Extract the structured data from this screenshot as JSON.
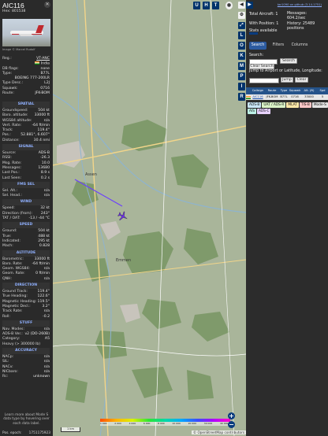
{
  "aircraft": {
    "callsign": "AIC116",
    "hex_label": "Hex:",
    "hex": "801538",
    "photo_credit": "Image © Marcel Rudolf",
    "registration_label": "Reg.:",
    "registration": "VT-ANC",
    "country": "India",
    "db_flags_label": "DB flags:",
    "db_flags": "none",
    "type_label": "Type:",
    "type": "B77L",
    "type_full": "BOEING 777-200LR",
    "type_desc_label": "Type Desc.:",
    "type_desc": "L2J",
    "squawk_label": "Squawk:",
    "squawk": "0716",
    "route_label": "Route:",
    "route": "JFK-BOM"
  },
  "sections": {
    "spatial": "SPATIAL",
    "signal": "SIGNAL",
    "fms": "FMS SEL",
    "wind": "WIND",
    "speed": "SPEED",
    "altitude": "ALTITUDE",
    "direction": "DIRECTION",
    "stuff": "STUFF",
    "accuracy": "ACCURACY"
  },
  "spatial": [
    {
      "k": "Groundspeed:",
      "v": "504 kt"
    },
    {
      "k": "Baro. altitude:",
      "v": "33000 ft"
    },
    {
      "k": "WGS84 altitude:",
      "v": "n/a"
    },
    {
      "k": "Vert. Rate:",
      "v": "-64 ft/min"
    },
    {
      "k": "Track:",
      "v": "119.4°"
    },
    {
      "k": "Pos.:",
      "v": "52.881°, 6.607°"
    },
    {
      "k": "Distance:",
      "v": "30.4 nmi"
    }
  ],
  "signal": [
    {
      "k": "Source:",
      "v": "ADS-B"
    },
    {
      "k": "RSSI:",
      "v": "-26.3"
    },
    {
      "k": "Msg. Rate:",
      "v": "10.0"
    },
    {
      "k": "Messages:",
      "v": "13680"
    },
    {
      "k": "Last Pos.:",
      "v": "8.9 s"
    },
    {
      "k": "Last Seen:",
      "v": "0.2 s"
    }
  ],
  "fms": [
    {
      "k": "Sel. Alt.:",
      "v": "n/a"
    },
    {
      "k": "Sel. Head.:",
      "v": "n/a"
    }
  ],
  "wind": [
    {
      "k": "Speed:",
      "v": "32 kt"
    },
    {
      "k": "Direction (from):",
      "v": "243°"
    },
    {
      "k": "TAT / OAT:",
      "v": "-13 / -44 °C"
    }
  ],
  "speed": [
    {
      "k": "Ground:",
      "v": "504 kt"
    },
    {
      "k": "True:",
      "v": "488 kt"
    },
    {
      "k": "Indicated:",
      "v": "295 kt"
    },
    {
      "k": "Mach:",
      "v": "0.828"
    }
  ],
  "altitude": [
    {
      "k": "Barometric:",
      "v": "33000 ft"
    },
    {
      "k": "Baro. Rate:",
      "v": "-64 ft/min"
    },
    {
      "k": "Geom. WGS84:",
      "v": "n/a"
    },
    {
      "k": "Geom. Rate:",
      "v": "0 ft/min"
    },
    {
      "k": "QNH:",
      "v": "n/a"
    }
  ],
  "direction": [
    {
      "k": "Ground Track:",
      "v": "119.4°"
    },
    {
      "k": "True Heading:",
      "v": "122.6°"
    },
    {
      "k": "Magnetic Heading:",
      "v": "119.5°"
    },
    {
      "k": "Magnetic Decl.:",
      "v": "3.2°"
    },
    {
      "k": "Track Rate:",
      "v": "n/a"
    },
    {
      "k": "Roll:",
      "v": "-0.2"
    }
  ],
  "stuff": [
    {
      "k": "Nav. Modes:",
      "v": "n/a"
    },
    {
      "k": "ADS-B Ver.:",
      "v": "v2 (DO-260B)"
    },
    {
      "k": "Category:",
      "v": "A5"
    },
    {
      "k": "Heavy (> 300000 lb)",
      "v": ""
    }
  ],
  "accuracy": [
    {
      "k": "NACp:",
      "v": "n/a"
    },
    {
      "k": "SIL:",
      "v": "n/a"
    },
    {
      "k": "NACv:",
      "v": "n/a"
    },
    {
      "k": "NICbaro:",
      "v": "n/a"
    },
    {
      "k": "Rc:",
      "v": "unknown"
    }
  ],
  "footer": {
    "learn_more": "Learn more about Mode S data type by hovering over each data label.",
    "epoch_label": "Pos. epoch:",
    "epoch": "1751175923"
  },
  "map": {
    "top_buttons": [
      "U",
      "H",
      "T"
    ],
    "side_buttons": [
      "L",
      "O",
      "K",
      "M",
      "P",
      "I",
      "R"
    ],
    "place_labels": [
      "Assen",
      "Emmen"
    ],
    "scale": "1 km",
    "altitude_ticks": [
      "1 000",
      "2 000",
      "4 000",
      "6 000",
      "8 000",
      "10 000",
      "20 000",
      "30 000",
      "40 000+"
    ],
    "zoom_in": "+",
    "zoom_out": "−",
    "attribution": "© OpenStreetMap contributors"
  },
  "right": {
    "github": "tar1090 on github (3.14.1751)",
    "total_aircraft": "Total Aircraft: 1",
    "with_position": "With Position: 1",
    "stats_available": "Stats available",
    "messages": "Messages: 604.2/sec",
    "history": "History: 25489 positions",
    "tabs": [
      "Search",
      "Filters",
      "Columns"
    ],
    "search_label": "Search:",
    "search_button": "Search",
    "clear_search": "Clear Search",
    "jump_label": "Jump to Airport or Latitude, Longitude:",
    "jump_button": "Jump",
    "clear_button": "Clear"
  },
  "table": {
    "headers": [
      "",
      "Callsign",
      "Route",
      "Type",
      "Squawk",
      "Alt. (ft)",
      "Spd"
    ],
    "row": [
      "",
      "AIC116",
      "JFK-BOM",
      "B77L",
      "0716",
      "33000",
      "5"
    ]
  },
  "source_filters": [
    {
      "label": "ADS-B",
      "color": "#c9e6f7"
    },
    {
      "label": "UAT / ADS-R",
      "color": "#d9f2c6"
    },
    {
      "label": "MLAT",
      "color": "#ffe8a8"
    },
    {
      "label": "TIS-B",
      "color": "#ffc7c7"
    },
    {
      "label": "Mode-S",
      "color": "#e4e4e4"
    },
    {
      "label": "AIS",
      "color": "#bdf0e6"
    },
    {
      "label": "ADS-C",
      "color": "#e8d2ff"
    }
  ],
  "colors": {
    "accent": "#00336b",
    "section": "#8fb0ff",
    "trail": "#6a3cff",
    "plane": "#6a2ee6"
  }
}
